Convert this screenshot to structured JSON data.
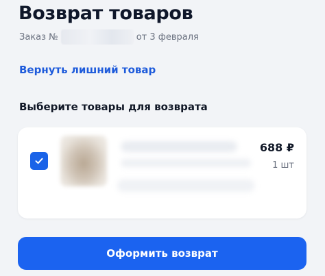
{
  "header": {
    "title": "Возврат товаров",
    "order_prefix": "Заказ №",
    "order_date": "от 3 февраля"
  },
  "links": {
    "return_extra": "Вернуть лишний товар"
  },
  "section": {
    "title": "Выберите товары для возврата"
  },
  "items": [
    {
      "checked": true,
      "price": "688 ₽",
      "quantity": "1 шт"
    }
  ],
  "actions": {
    "submit_label": "Оформить возврат"
  },
  "colors": {
    "accent": "#1b63f0",
    "link": "#1e5bdb",
    "background": "#f2f4f7",
    "card": "#ffffff"
  },
  "icons": {
    "checkbox": "check-icon"
  }
}
